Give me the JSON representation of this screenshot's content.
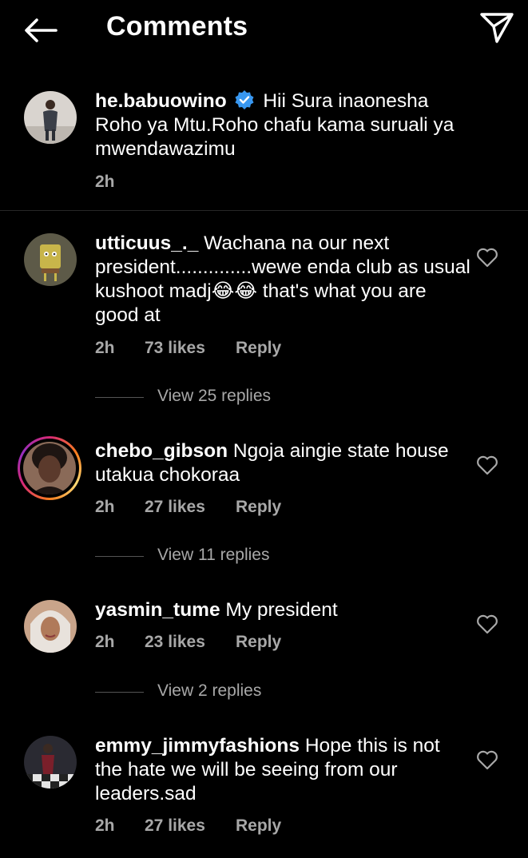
{
  "header": {
    "title": "Comments",
    "back_icon": "arrow-left-icon",
    "send_icon": "paper-plane-icon"
  },
  "caption": {
    "username": "he.babuowino",
    "verified": true,
    "text": "Hii Sura inaonesha Roho ya Mtu.Roho chafu kama suruali ya mwendawazimu",
    "time": "2h"
  },
  "comments": [
    {
      "username": "utticuus_._",
      "text": "Wachana na our next president..............wewe enda club as usual kushoot madj😂😂 that's what you are good at",
      "time": "2h",
      "likes": "73 likes",
      "reply_label": "Reply",
      "view_replies": "View 25 replies"
    },
    {
      "username": "chebo_gibson",
      "text": "Ngoja aingie state house utakua chokoraa",
      "time": "2h",
      "likes": "27 likes",
      "reply_label": "Reply",
      "view_replies": "View 11 replies",
      "has_story": true
    },
    {
      "username": "yasmin_tume",
      "text": "My president",
      "time": "2h",
      "likes": "23 likes",
      "reply_label": "Reply",
      "view_replies": "View 2 replies"
    },
    {
      "username": "emmy_jimmyfashions",
      "text": "Hope this is not the hate we will be seeing from our leaders.sad",
      "time": "2h",
      "likes": "27 likes",
      "reply_label": "Reply"
    }
  ],
  "colors": {
    "background": "#000000",
    "text": "#ffffff",
    "secondary": "#a8a8a8",
    "verified": "#3897f0",
    "divider": "#262626"
  }
}
